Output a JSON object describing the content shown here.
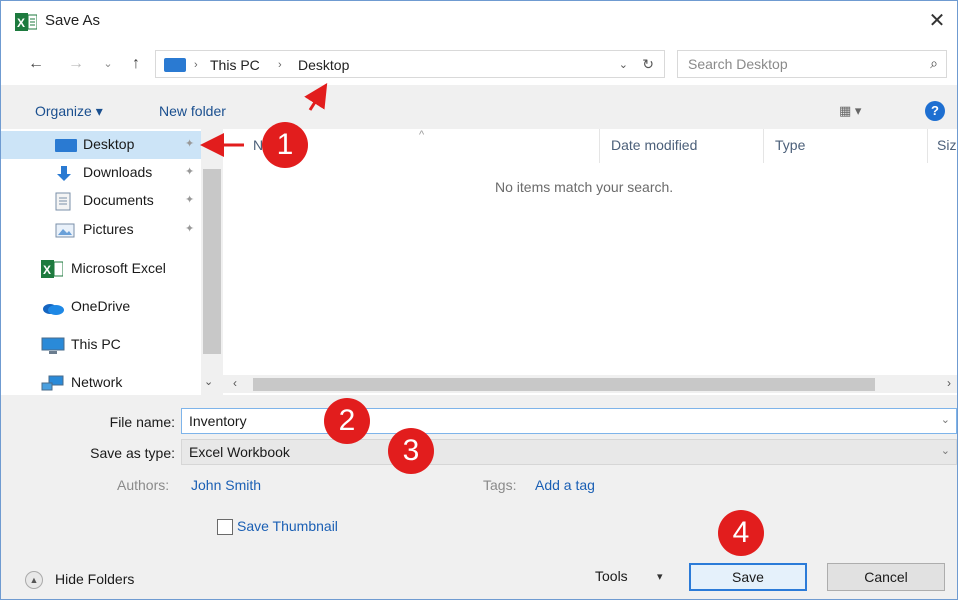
{
  "window": {
    "title": "Save As",
    "close_glyph": "✕"
  },
  "nav": {
    "back_glyph": "←",
    "forward_glyph": "→",
    "recent_glyph": "⌄",
    "up_glyph": "↑"
  },
  "address": {
    "crumb_sep": "›",
    "crumbs": [
      "This PC",
      "Desktop"
    ],
    "dropdown_glyph": "⌄",
    "refresh_glyph": "↻"
  },
  "search": {
    "placeholder": "Search Desktop",
    "icon_glyph": "⌕"
  },
  "toolbar": {
    "organize_label": "Organize ▾",
    "new_folder_label": "New folder",
    "view_label": "▦ ▾",
    "help_glyph": "?"
  },
  "sidebar": {
    "pin_glyph": "✦",
    "items": [
      {
        "label": "Desktop",
        "icon": "desktop-folder-icon",
        "pinned": true,
        "selected": true
      },
      {
        "label": "Downloads",
        "icon": "downloads-icon",
        "pinned": true
      },
      {
        "label": "Documents",
        "icon": "documents-icon",
        "pinned": true
      },
      {
        "label": "Pictures",
        "icon": "pictures-icon",
        "pinned": true
      },
      {
        "label": "Microsoft Excel",
        "icon": "excel-icon"
      },
      {
        "label": "OneDrive",
        "icon": "onedrive-icon"
      },
      {
        "label": "This PC",
        "icon": "this-pc-icon"
      },
      {
        "label": "Network",
        "icon": "network-icon"
      }
    ],
    "scroll_down_glyph": "⌄"
  },
  "filelist": {
    "columns": [
      "Name",
      "Date modified",
      "Type",
      "Size"
    ],
    "sort_glyph": "^",
    "empty_message": "No items match your search.",
    "scroll_left_glyph": "‹",
    "scroll_right_glyph": "›"
  },
  "form": {
    "file_name_label": "File name:",
    "file_name_value": "Inventory",
    "save_type_label": "Save as type:",
    "save_type_value": "Excel Workbook",
    "dropdown_glyph": "⌄",
    "authors_label": "Authors:",
    "authors_value": "John Smith",
    "tags_label": "Tags:",
    "tags_value": "Add a tag",
    "thumbnail_label": "Save Thumbnail",
    "thumbnail_checked": false
  },
  "footer": {
    "hide_folders_label": "Hide Folders",
    "hide_folders_glyph": "▲",
    "tools_label": "Tools",
    "tools_caret": "▾",
    "save_label": "Save",
    "cancel_label": "Cancel"
  },
  "annotations": [
    "1",
    "2",
    "3",
    "4"
  ],
  "colors": {
    "annotation": "#e21d1d",
    "accent": "#2b7bd8",
    "selected_row": "#cce4f7",
    "link": "#1a5fb4"
  }
}
